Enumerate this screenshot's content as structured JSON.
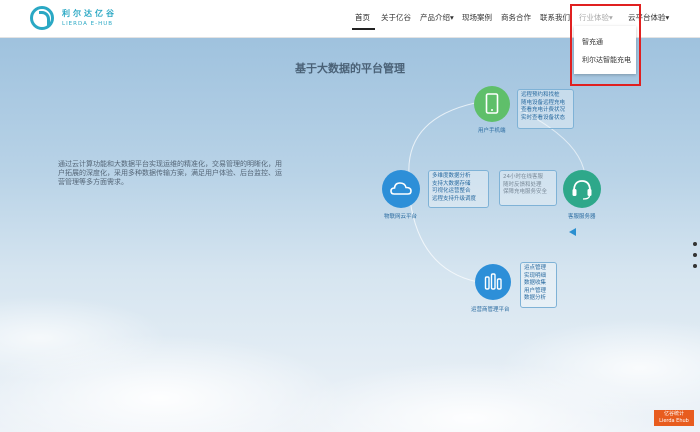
{
  "brand": {
    "name_cn": "利尔达亿谷",
    "name_en": "LIERDA E-HUB"
  },
  "nav": {
    "items": [
      {
        "label": "首页"
      },
      {
        "label": "关于亿谷"
      },
      {
        "label": "产品介绍"
      },
      {
        "label": "现场案例"
      },
      {
        "label": "商务合作"
      },
      {
        "label": "联系我们"
      },
      {
        "label": "行业体验"
      },
      {
        "label": "云平台体验"
      }
    ],
    "caret": "▾"
  },
  "dropdown": {
    "items": [
      {
        "label": "智充通"
      },
      {
        "label": "利尔达智能充电"
      }
    ]
  },
  "main": {
    "title": "基于大数据的平台管理",
    "description": "通过云计算功能和大数据平台实现运维的精准化，交易管理的明晰化，用户拓展的深度化，采用多种数据传输方案，满足用户体验、后台监控、运营管理等多方面需求。"
  },
  "diagram": {
    "mobile": {
      "label": "用户手机端",
      "lines": [
        "远程预约和找桩",
        "随电设备远程充电",
        "查看充电计费状况",
        "实时查看设备状态"
      ]
    },
    "cloud": {
      "label": "物联网云平台",
      "lines": [
        "多维度数据分析",
        "支持大数据存储",
        "可视化运营整合",
        "远程支持升级调度"
      ]
    },
    "service": {
      "label": "客服服务器",
      "lines": [
        "24小时在线客服",
        "随时反馈和处理",
        "保障充电服务安全"
      ]
    },
    "ops": {
      "label": "运营商管理平台",
      "lines": [
        "运点管理",
        "实现明细",
        "数据收集",
        "用户管理",
        "数据分析"
      ]
    }
  },
  "badge": {
    "line1": "亿谷统计",
    "line2": "Lierda Ehub"
  },
  "colors": {
    "accent": "#2aa8c4",
    "highlight_box": "#e02020",
    "badge": "#e85c1e"
  }
}
